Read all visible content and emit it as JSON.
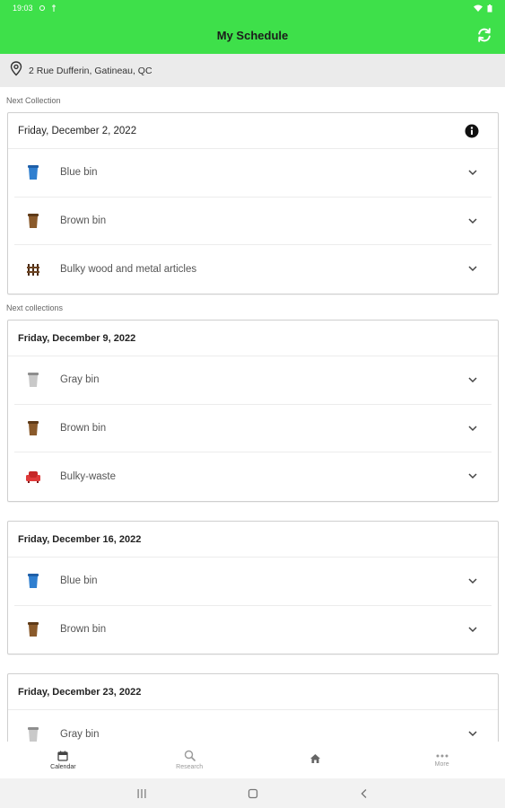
{
  "status_bar": {
    "time": "19:03"
  },
  "app_bar": {
    "title": "My Schedule"
  },
  "address": {
    "text": "2 Rue Dufferin, Gatineau, QC"
  },
  "sections": {
    "next_collection_label": "Next Collection",
    "next_collections_label": "Next collections"
  },
  "cards": [
    {
      "date": "Friday, December 2, 2022",
      "items": [
        {
          "label": "Blue bin",
          "icon": "blue-bin-icon"
        },
        {
          "label": "Brown bin",
          "icon": "brown-bin-icon"
        },
        {
          "label": "Bulky wood and metal articles",
          "icon": "wood-fence-icon"
        }
      ]
    },
    {
      "date": "Friday, December 9, 2022",
      "items": [
        {
          "label": "Gray bin",
          "icon": "gray-bin-icon"
        },
        {
          "label": "Brown bin",
          "icon": "brown-bin-icon"
        },
        {
          "label": "Bulky-waste",
          "icon": "armchair-icon"
        }
      ]
    },
    {
      "date": "Friday, December 16, 2022",
      "items": [
        {
          "label": "Blue bin",
          "icon": "blue-bin-icon"
        },
        {
          "label": "Brown bin",
          "icon": "brown-bin-icon"
        }
      ]
    },
    {
      "date": "Friday, December 23, 2022",
      "items": [
        {
          "label": "Gray bin",
          "icon": "gray-bin-icon"
        }
      ]
    }
  ],
  "bottom_nav": {
    "calendar": "Calendar",
    "research": "Research",
    "home": "",
    "more": "More"
  },
  "colors": {
    "accent": "#3ee04a",
    "blue_bin": "#2f7fd0",
    "brown_bin": "#8a5a2b",
    "gray_bin": "#b8b8b8",
    "bulky_waste": "#e03a3a"
  }
}
